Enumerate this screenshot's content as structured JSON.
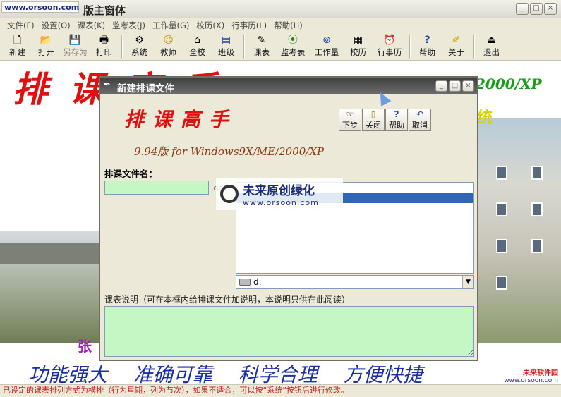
{
  "watermark_top": "www.orsoon.com",
  "main": {
    "title": "版主窗体",
    "window_buttons": [
      "_",
      "□",
      "×"
    ]
  },
  "menu": [
    "文件(F)",
    "设置(O)",
    "课表(K)",
    "监考表(J)",
    "工作量(G)",
    "校历(X)",
    "行事历(L)",
    "帮助(H)"
  ],
  "toolbar": [
    {
      "label": "新建",
      "icon": "new-file-icon",
      "glyph": "🗋"
    },
    {
      "label": "打开",
      "icon": "open-folder-icon",
      "glyph": "📂"
    },
    {
      "label": "另存为",
      "icon": "save-icon",
      "glyph": "💾"
    },
    {
      "label": "打印",
      "icon": "printer-icon",
      "glyph": "🖶"
    },
    {
      "label": "系统",
      "icon": "tools-icon",
      "glyph": "⚙"
    },
    {
      "label": "教师",
      "icon": "smiley-icon",
      "glyph": "☺"
    },
    {
      "label": "全校",
      "icon": "school-icon",
      "glyph": "⌂"
    },
    {
      "label": "班级",
      "icon": "class-icon",
      "glyph": "▤"
    },
    {
      "label": "课表",
      "icon": "timetable-icon",
      "glyph": "✎"
    },
    {
      "label": "监考表",
      "icon": "traffic-light-icon",
      "glyph": "⦿"
    },
    {
      "label": "工作量",
      "icon": "workload-icon",
      "glyph": "⊚"
    },
    {
      "label": "校历",
      "icon": "calendar-icon",
      "glyph": "▦"
    },
    {
      "label": "行事历",
      "icon": "alarm-clock-icon",
      "glyph": "⏰"
    },
    {
      "label": "帮助",
      "icon": "help-icon",
      "glyph": "?"
    },
    {
      "label": "关于",
      "icon": "about-icon",
      "glyph": "✐"
    },
    {
      "label": "退出",
      "icon": "exit-icon",
      "glyph": "⏏"
    }
  ],
  "background": {
    "title": "排课高手",
    "version_right": "2000/XP",
    "yellow_fragment": "统",
    "purple_char": "张",
    "slogan": "功能强大 准确可靠 科学合理 方便快捷"
  },
  "watermark_bottom": {
    "line1": "未来软件园",
    "line2": "www.orsoon.com"
  },
  "statusbar": "已设定的课表排列方式为横排（行为星期，列为节次），如果不适合，可以按“系统”按钮后进行修改。",
  "dialog": {
    "title": "新建排课文件",
    "heading": "排课高手",
    "version": "9.94版 for Windows9X/ME/2000/XP",
    "buttons": [
      {
        "label": "下步",
        "icon": "next-hand-icon",
        "glyph": "☞"
      },
      {
        "label": "关闭",
        "icon": "close-door-icon",
        "glyph": "▯"
      },
      {
        "label": "帮助",
        "icon": "help-book-icon",
        "glyph": "?"
      },
      {
        "label": "取消",
        "icon": "undo-icon",
        "glyph": "↶"
      }
    ],
    "filename_label": "排课文件名：",
    "filename_value": "",
    "extension": ".dat",
    "drive": "d:",
    "description_label": "课表说明（可在本框内给排课文件加说明，本说明只供在此阅读）"
  },
  "watermark_center": {
    "line1": "未来原创绿化",
    "line2": "www.orsoon.com"
  }
}
